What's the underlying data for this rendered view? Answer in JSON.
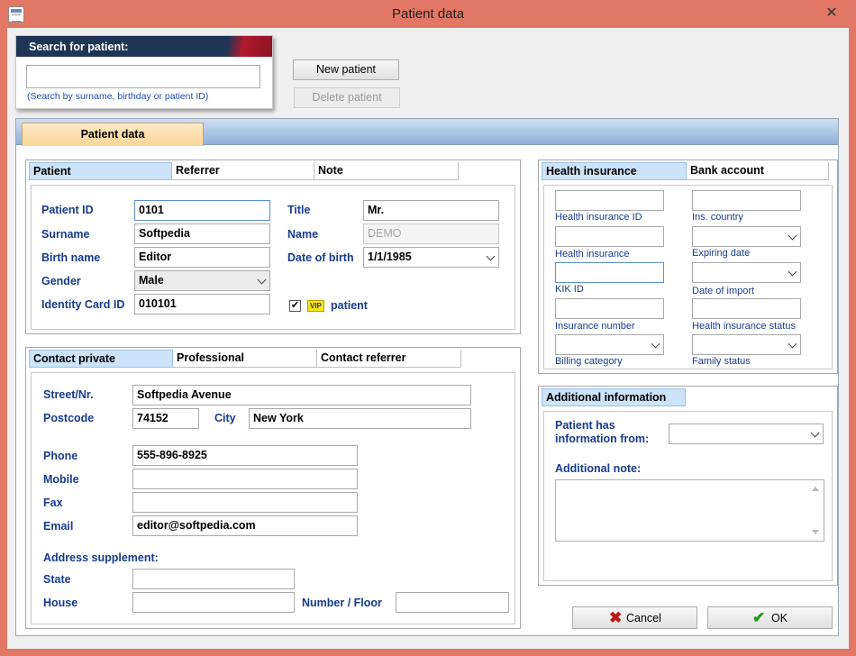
{
  "window": {
    "title": "Patient data",
    "close_glyph": "✕"
  },
  "search": {
    "header": "Search for patient:",
    "value": "",
    "hint": "(Search by surname, birthday or patient ID)"
  },
  "toolbar": {
    "new_patient": "New patient",
    "delete_patient": "Delete patient"
  },
  "main_tab": "Patient data",
  "patient_section": {
    "tabs": [
      "Patient",
      "Referrer",
      "Note"
    ],
    "labels": {
      "patient_id": "Patient ID",
      "surname": "Surname",
      "birth_name": "Birth name",
      "gender": "Gender",
      "identity_card": "Identity Card ID",
      "title": "Title",
      "name": "Name",
      "dob": "Date of birth",
      "vip_patient": "patient"
    },
    "values": {
      "patient_id": "0101",
      "surname": "Softpedia",
      "birth_name": "Editor",
      "gender": "Male",
      "identity_card": "010101",
      "title": "Mr.",
      "name": "DEMO",
      "dob": "1/1/1985"
    },
    "vip_badge": "VIP",
    "vip_checked": "✔"
  },
  "contact_section": {
    "tabs": [
      "Contact private",
      "Professional",
      "Contact referrer"
    ],
    "labels": {
      "street": "Street/Nr.",
      "postcode": "Postcode",
      "city": "City",
      "phone": "Phone",
      "mobile": "Mobile",
      "fax": "Fax",
      "email": "Email",
      "address_supplement": "Address supplement:",
      "state": "State",
      "house": "House",
      "number_floor": "Number / Floor"
    },
    "values": {
      "street": "Softpedia Avenue",
      "postcode": "74152",
      "city": "New York",
      "phone": "555-896-8925",
      "mobile": "",
      "fax": "",
      "email": "editor@softpedia.com",
      "state": "",
      "house": "",
      "number_floor": ""
    }
  },
  "insurance_section": {
    "tabs": [
      "Health insurance",
      "Bank account"
    ],
    "labels": {
      "health_insurance_id": "Health insurance ID",
      "ins_country": "Ins. country",
      "health_insurance": "Health insurance",
      "expiring_date": "Expiring date",
      "kik_id": "KIK ID",
      "date_of_import": "Date of import",
      "insurance_number": "Insurance number",
      "health_insurance_status": "Health insurance status",
      "billing_category": "Billing category",
      "family_status": "Family status"
    }
  },
  "additional_section": {
    "tab": "Additional information",
    "info_from_line1": "Patient has",
    "info_from_line2": "information from:",
    "note_label": "Additional note:",
    "note_value": ""
  },
  "actions": {
    "cancel": "Cancel",
    "ok": "OK",
    "cancel_glyph": "✖",
    "ok_glyph": "✔"
  },
  "colors": {
    "accent_label": "#173b8c",
    "tab_active": "#cde3f9",
    "main_tab": "#fcd59a",
    "window_frame": "#e27765"
  }
}
